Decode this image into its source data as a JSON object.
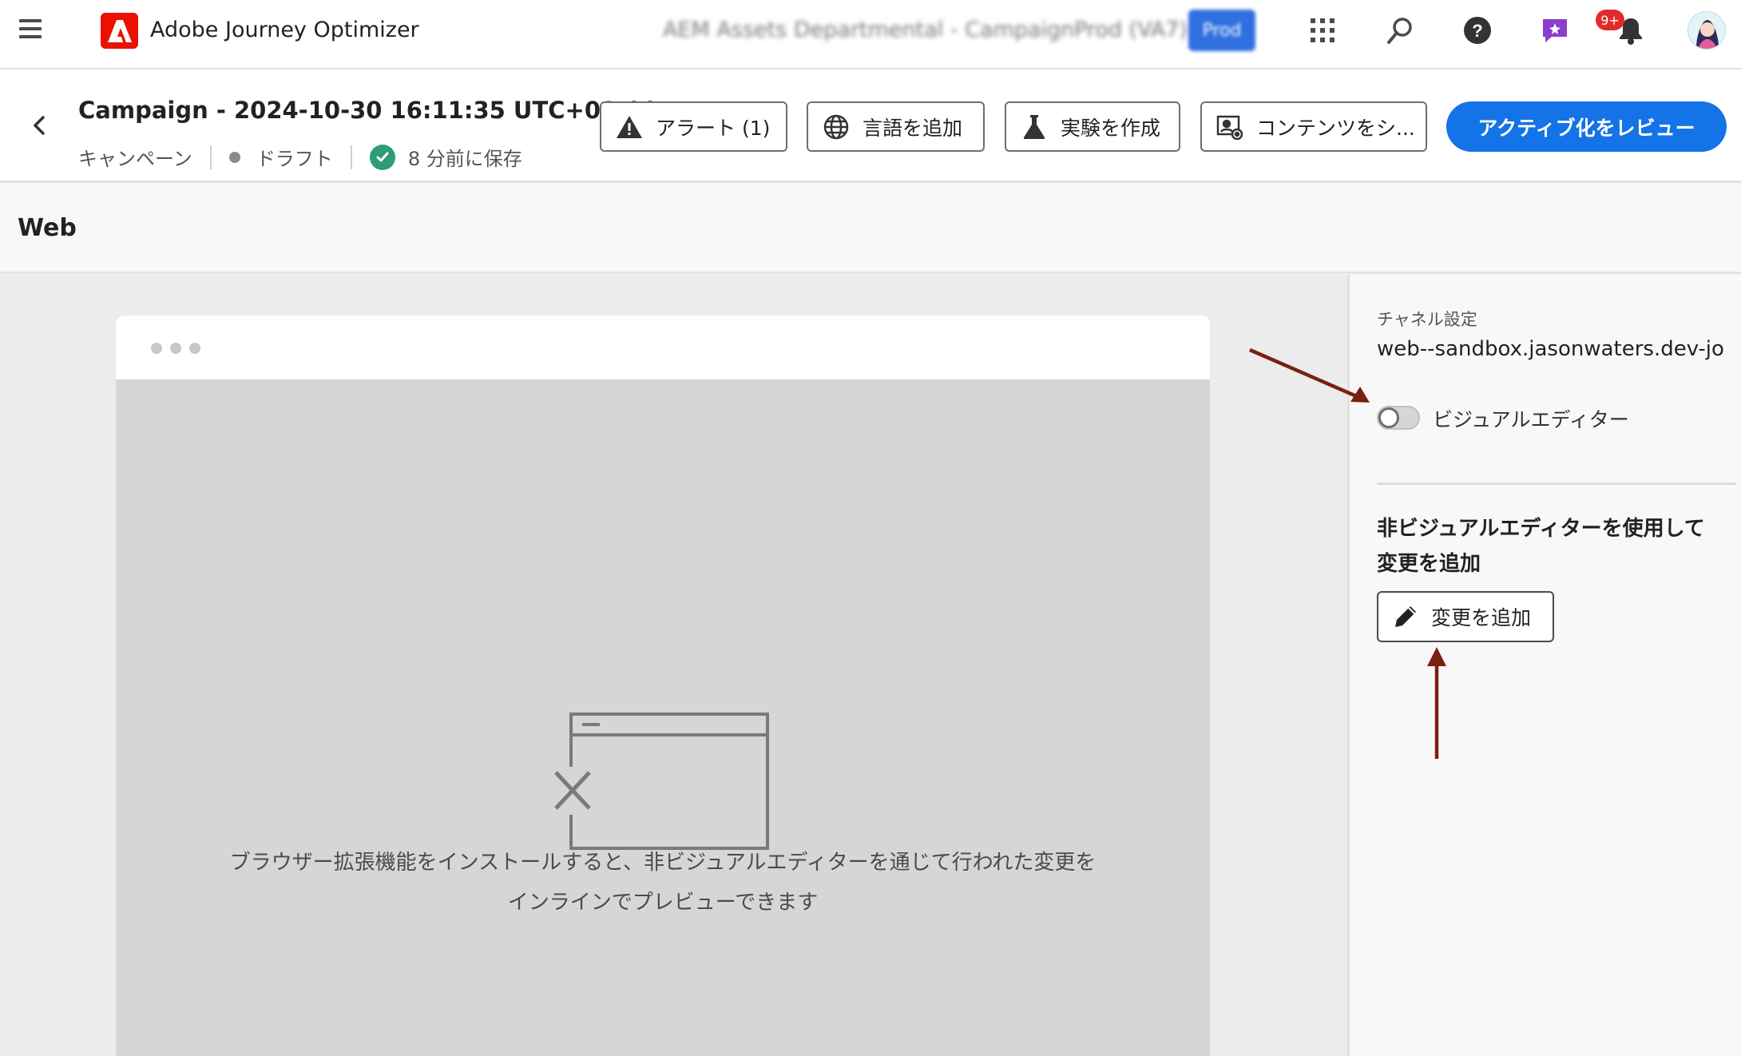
{
  "topbar": {
    "app_title": "Adobe Journey Optimizer",
    "org_name": "AEM Assets Departmental - Campaign",
    "sandbox_name": "Prod (VA7)",
    "sandbox_badge": "Prod",
    "notification_count": "9+",
    "icons": [
      "menu-icon",
      "adobe-logo",
      "app-switcher-icon",
      "search-icon",
      "help-icon",
      "feedback-icon",
      "bell-icon",
      "avatar"
    ]
  },
  "campaign": {
    "title": "Campaign - 2024-10-30 16:11:35 UTC+01:00",
    "type": "キャンペーン",
    "status": "ドラフト",
    "saved": "8 分前に保存"
  },
  "actions": {
    "alerts": "アラート (1)",
    "add_language": "言語を追加",
    "create_experiment": "実験を作成",
    "simulate_content": "コンテンツをシ...",
    "review_activate": "アクティブ化をレビュー"
  },
  "section": {
    "title": "Web"
  },
  "preview": {
    "empty_line1": "ブラウザー拡張機能をインストールすると、非ビジュアルエディターを通じて行われた変更を",
    "empty_line2": "インラインでプレビューできます"
  },
  "panel": {
    "channel_label": "チャネル設定",
    "channel_value": "web--sandbox.jasonwaters.dev-jo",
    "visual_editor_label": "ビジュアルエディター",
    "visual_editor_on": false,
    "non_visual_heading": "非ビジュアルエディターを使用して変更を追加",
    "add_change_label": "変更を追加"
  },
  "colors": {
    "accent": "#1473e6",
    "brand_red": "#eb1000",
    "success": "#2d9d78",
    "annotation": "#7a1f12"
  }
}
